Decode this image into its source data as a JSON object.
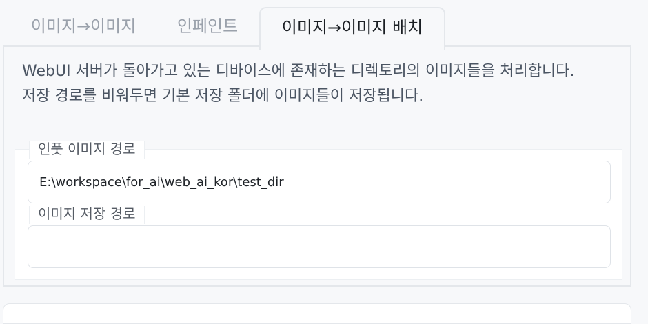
{
  "tabs": [
    {
      "label": "이미지→이미지",
      "active": false
    },
    {
      "label": "인페인트",
      "active": false
    },
    {
      "label": "이미지→이미지 배치",
      "active": true
    }
  ],
  "description": {
    "line1": "WebUI 서버가 돌아가고 있는 디바이스에 존재하는 디렉토리의 이미지들을 처리합니다.",
    "line2": "저장 경로를 비워두면 기본 저장 폴더에 이미지들이 저장됩니다."
  },
  "fields": {
    "input_dir": {
      "label": "인풋 이미지 경로",
      "value": "E:\\workspace\\for_ai\\web_ai_kor\\test_dir"
    },
    "output_dir": {
      "label": "이미지 저장 경로",
      "value": ""
    }
  },
  "colors": {
    "active_tab_text": "#1b1f24",
    "inactive_tab_text": "#9aa1ab",
    "border": "#e4e7eb",
    "background": "#f7f8fa"
  }
}
